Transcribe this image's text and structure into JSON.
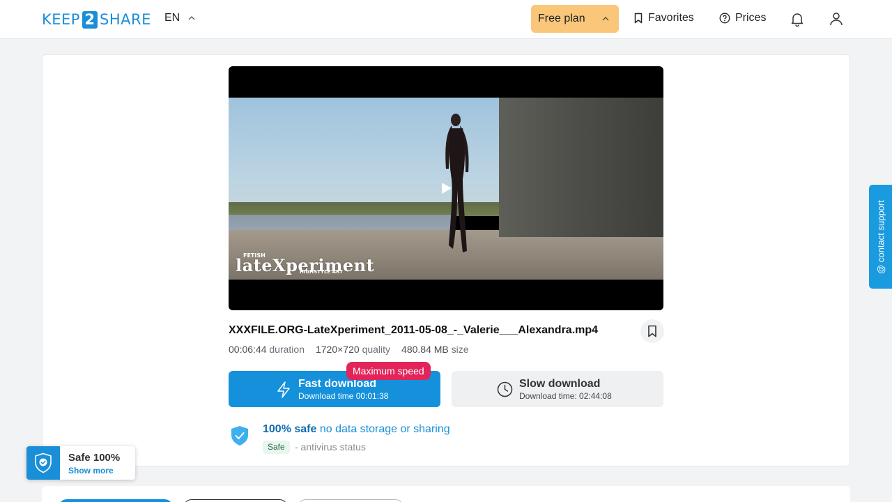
{
  "header": {
    "logo_left": "KEEP",
    "logo_mid": "2",
    "logo_right": "SHARE",
    "language": "EN",
    "plan_label": "Free plan",
    "favorites_label": "Favorites",
    "prices_label": "Prices",
    "icons": {
      "favorites": "bookmark-icon",
      "prices": "question-circle-icon",
      "notifications": "bell-icon",
      "account": "user-icon"
    }
  },
  "video": {
    "watermark_small": "FETISH",
    "watermark_main": "lateXperiment",
    "watermark_sub": "HIGHSTYLE ART"
  },
  "file": {
    "name": "XXXFILE.ORG-LateXperiment_2011-05-08_-_Valerie___Alexandra.mp4",
    "duration_value": "00:06:44",
    "duration_label": "duration",
    "quality_value": "1720×720",
    "quality_label": "quality",
    "size_value": "480.84 MB",
    "size_label": "size"
  },
  "download": {
    "fast_title": "Fast download",
    "fast_subtitle": "Download time 00:01:38",
    "badge": "Maximum speed",
    "slow_title": "Slow download",
    "slow_subtitle": "Download time: 02:44:08"
  },
  "safety": {
    "headline_strong": "100% safe",
    "headline_rest": "no data storage or sharing",
    "tag": "Safe",
    "antivirus": "- antivirus status"
  },
  "support_label": "@ contact support",
  "toast": {
    "title": "Safe 100%",
    "link": "Show more"
  },
  "colors": {
    "accent": "#1591dc",
    "plan": "#fac67a",
    "badge": "#e2245a",
    "support": "#1a9be0"
  }
}
